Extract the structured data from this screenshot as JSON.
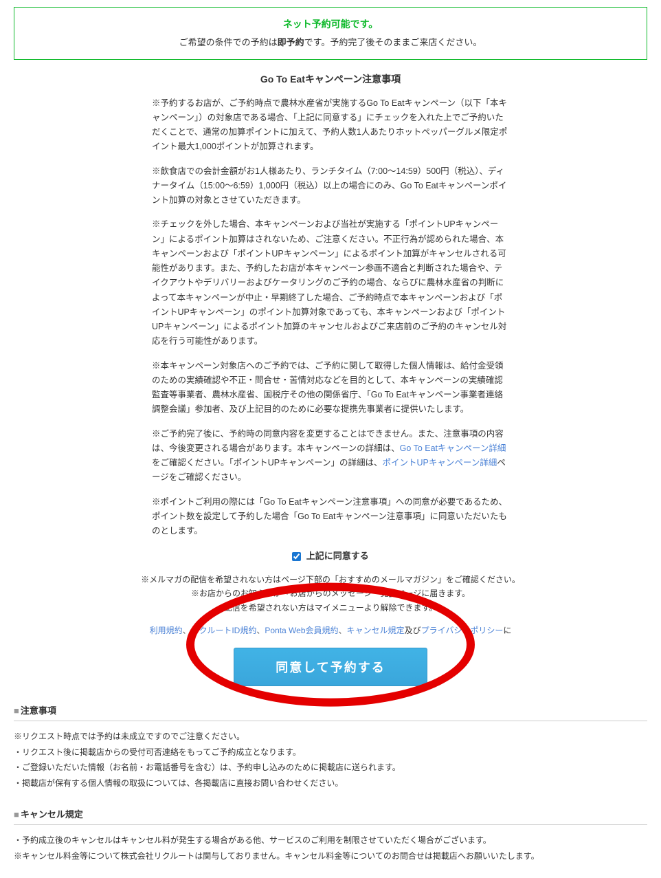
{
  "banner": {
    "title": "ネット予約可能です。",
    "sub_pre": "ご希望の条件での予約は",
    "sub_bold": "即予約",
    "sub_post": "です。予約完了後そのままご来店ください。"
  },
  "campaign_title": "Go To Eatキャンペーン注意事項",
  "terms": {
    "p1": "※予約するお店が、ご予約時点で農林水産省が実施するGo To Eatキャンペーン（以下「本キャンペーン」）の対象店である場合、「上記に同意する」にチェックを入れた上でご予約いただくことで、通常の加算ポイントに加えて、予約人数1人あたりホットペッパーグルメ限定ポイント最大1,000ポイントが加算されます。",
    "p2": "※飲食店での会計金額がお1人様あたり、ランチタイム（7:00～14:59）500円（税込）、ディナータイム（15:00～6:59）1,000円（税込）以上の場合にのみ、Go To Eatキャンペーンポイント加算の対象とさせていただきます。",
    "p3": "※チェックを外した場合、本キャンペーンおよび当社が実施する「ポイントUPキャンペーン」によるポイント加算はされないため、ご注意ください。不正行為が認められた場合、本キャンペーンおよび「ポイントUPキャンペーン」によるポイント加算がキャンセルされる可能性があります。また、予約したお店が本キャンペーン参画不適合と判断された場合や、テイクアウトやデリバリーおよびケータリングのご予約の場合、ならびに農林水産省の判断によって本キャンペーンが中止・早期終了した場合、ご予約時点で本キャンペーンおよび「ポイントUPキャンペーン」のポイント加算対象であっても、本キャンペーンおよび「ポイントUPキャンペーン」によるポイント加算のキャンセルおよびご来店前のご予約のキャンセル対応を行う可能性があります。",
    "p4": "※本キャンペーン対象店へのご予約では、ご予約に関して取得した個人情報は、給付金受領のための実績確認や不正・問合せ・苦情対応などを目的として、本キャンペーンの実績確認監査等事業者、農林水産省、国税庁その他の関係省庁、「Go To Eatキャンペーン事業者連絡調整会議」参加者、及び上記目的のために必要な提携先事業者に提供いたします。",
    "p5_pre": "※ご予約完了後に、予約時の同意内容を変更することはできません。また、注意事項の内容は、今後変更される場合があります。本キャンペーンの詳細は、",
    "p5_link1": "Go To Eatキャンペーン詳細",
    "p5_mid": "をご確認ください。「ポイントUPキャンペーン」の詳細は、",
    "p5_link2": "ポイントUPキャンペーン詳細",
    "p5_post": "ページをご確認ください。",
    "p6": "※ポイントご利用の際には「Go To Eatキャンペーン注意事項」への同意が必要であるため、ポイント数を設定して予約した場合「Go To Eatキャンペーン注意事項」に同意いただいたものとします。"
  },
  "agree_label": "上記に同意する",
  "mailmag": {
    "l1": "※メルマガの配信を希望されない方はページ下部の「おすすめのメールマガジン」をご確認ください。",
    "l2": "※お店からのお知らせが「お店からのメッセージ一覧」ページに届きます。",
    "l3": "配信を希望されない方はマイメニューより解除できます。"
  },
  "policies": {
    "riyou": "利用規約",
    "recruit": "リクルートID規約",
    "ponta": "Ponta Web会員規約",
    "cancel": "キャンセル規定",
    "and": "及び",
    "privacy": "プライバシーポリシー",
    "tail": "に"
  },
  "submit_label": "同意して予約する",
  "notice": {
    "head": "注意事項",
    "n1": "※リクエスト時点では予約は未成立ですのでご注意ください。",
    "n2": "・リクエスト後に掲載店からの受付可否連絡をもってご予約成立となります。",
    "n3": "・ご登録いただいた情報（お名前・お電話番号を含む）は、予約申し込みのために掲載店に送られます。",
    "n4": "・掲載店が保有する個人情報の取扱については、各掲載店に直接お問い合わせください。"
  },
  "cancel_sec": {
    "head": "キャンセル規定",
    "c1": "・予約成立後のキャンセルはキャンセル料が発生する場合がある他、サービスのご利用を制限させていただく場合がございます。",
    "c2": "※キャンセル料金等について株式会社リクルートは関与しておりません。キャンセル料金等についてのお問合せは掲載店へお願いいたします。"
  }
}
